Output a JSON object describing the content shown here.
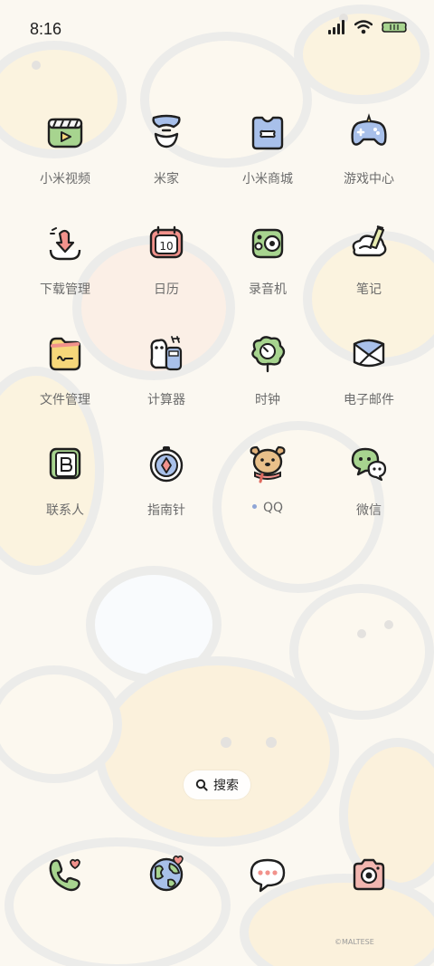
{
  "status_bar": {
    "time": "8:16",
    "icons": [
      "signal-icon",
      "wifi-icon",
      "battery-icon"
    ]
  },
  "apps": [
    {
      "label": "小米视频",
      "icon": "video-icon"
    },
    {
      "label": "米家",
      "icon": "mijia-icon"
    },
    {
      "label": "小米商城",
      "icon": "store-bag-icon"
    },
    {
      "label": "游戏中心",
      "icon": "gamepad-icon"
    },
    {
      "label": "下载管理",
      "icon": "download-icon"
    },
    {
      "label": "日历",
      "icon": "calendar-icon",
      "date": "10"
    },
    {
      "label": "录音机",
      "icon": "recorder-icon"
    },
    {
      "label": "笔记",
      "icon": "notes-icon"
    },
    {
      "label": "文件管理",
      "icon": "folder-icon"
    },
    {
      "label": "计算器",
      "icon": "calculator-icon"
    },
    {
      "label": "时钟",
      "icon": "clock-icon"
    },
    {
      "label": "电子邮件",
      "icon": "mail-icon"
    },
    {
      "label": "联系人",
      "icon": "contacts-icon"
    },
    {
      "label": "指南针",
      "icon": "compass-icon"
    },
    {
      "label": "QQ",
      "icon": "qq-dog-icon",
      "has_dot": true
    },
    {
      "label": "微信",
      "icon": "wechat-icon"
    }
  ],
  "search": {
    "label": "搜索"
  },
  "dock": [
    {
      "icon": "phone-icon"
    },
    {
      "icon": "browser-globe-icon"
    },
    {
      "icon": "messages-icon"
    },
    {
      "icon": "camera-icon"
    }
  ],
  "watermark": "©MALTESE",
  "colors": {
    "background": "#fbf8f1",
    "outline": "#1f1f1f",
    "green": "#a7d48f",
    "blue": "#a8c0ea",
    "yellow": "#f6d77a",
    "red": "#f2928c",
    "label": "#6b6b6b"
  }
}
